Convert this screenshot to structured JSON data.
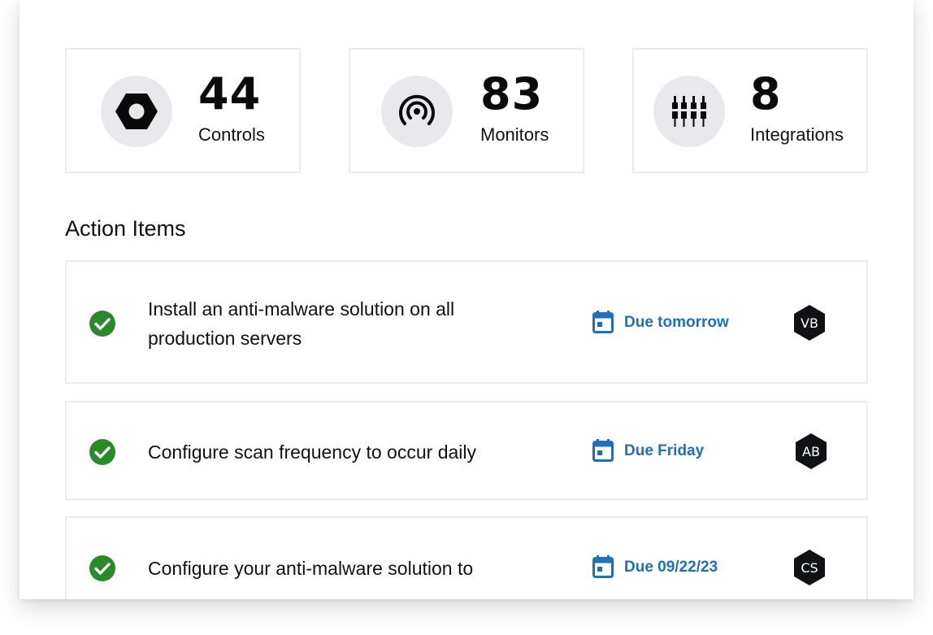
{
  "stats": [
    {
      "value": "44",
      "label": "Controls",
      "icon": "hex-nut-icon"
    },
    {
      "value": "83",
      "label": "Monitors",
      "icon": "signal-broadcast-icon"
    },
    {
      "value": "8",
      "label": "Integrations",
      "icon": "connectors-icon"
    }
  ],
  "action_items": {
    "title": "Action Items",
    "items": [
      {
        "text": "Install an anti-malware solution on all production servers",
        "due": "Due tomorrow",
        "assignee": "VB",
        "status": "complete"
      },
      {
        "text": "Configure scan frequency to occur daily",
        "due": "Due Friday",
        "assignee": "AB",
        "status": "complete"
      },
      {
        "text": "Configure your anti-malware solution to",
        "due": "Due 09/22/23",
        "assignee": "CS",
        "status": "complete"
      }
    ]
  },
  "colors": {
    "accent_blue": "#1f6fbf",
    "check_green": "#2a8a2a",
    "avatar_bg": "#0f1115",
    "icon_circle": "#e9e8ec"
  }
}
